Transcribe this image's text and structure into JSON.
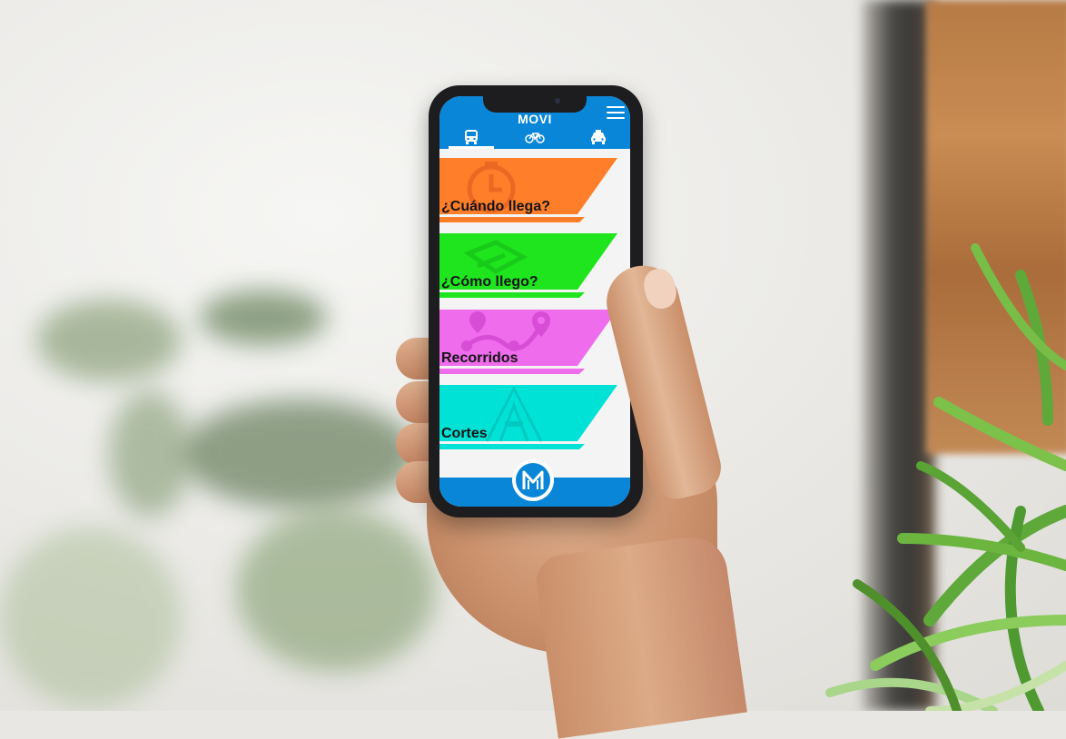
{
  "app": {
    "title": "MOVI",
    "logo_letter": "M"
  },
  "tabs": [
    {
      "name": "bus",
      "icon": "bus-icon",
      "active": true
    },
    {
      "name": "bike",
      "icon": "bicycle-icon",
      "active": false
    },
    {
      "name": "taxi",
      "icon": "taxi-icon",
      "active": false
    }
  ],
  "menu": [
    {
      "label": "¿Cuándo llega?",
      "color": "#ff7e2a",
      "icon": "clock-icon"
    },
    {
      "label": "¿Cómo llego?",
      "color": "#1fe51f",
      "icon": "map-icon"
    },
    {
      "label": "Recorridos",
      "color": "#ef6cec",
      "icon": "route-pin-icon"
    },
    {
      "label": "Cortes",
      "color": "#00e2d6",
      "icon": "road-closure-icon"
    }
  ],
  "colors": {
    "primary": "#0a86d9",
    "background": "#f4f4f4"
  }
}
